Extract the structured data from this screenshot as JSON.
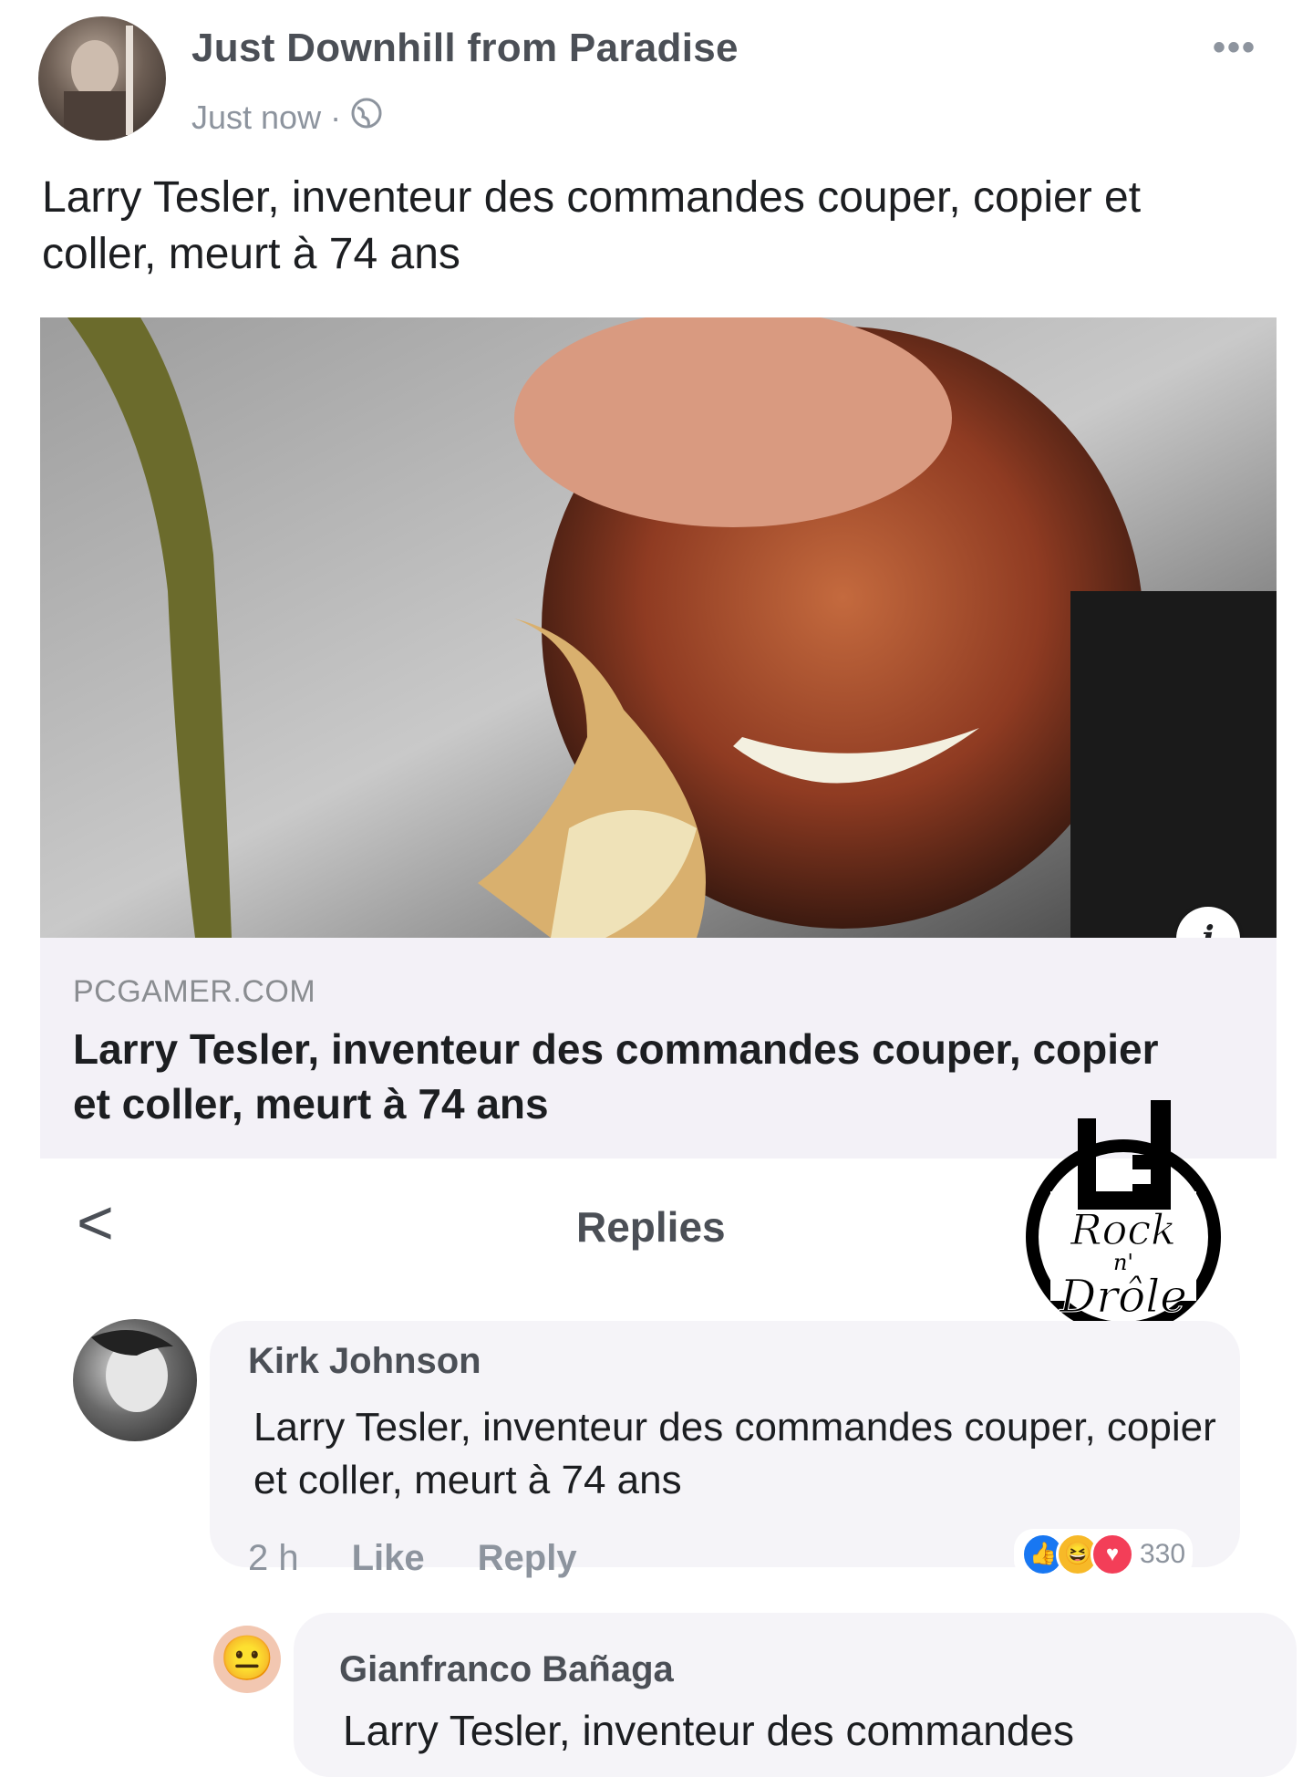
{
  "post": {
    "author": "Just Downhill from Paradise",
    "timestamp": "Just now ·",
    "timestamp_icon": "globe-icon",
    "more_icon": "more-options-icon",
    "more_label": "•••",
    "text": "Larry Tesler, inventeur des commandes couper, copier et coller, meurt à 74 ans"
  },
  "link_preview": {
    "image": "photo-of-smiling-man",
    "info_label": "i",
    "domain": "PCGAMER.COM",
    "title": "Larry Tesler, inventeur des commandes couper, copier et coller, meurt à 74 ans"
  },
  "replies": {
    "back_icon": "chevron-left-icon",
    "back_label": "<",
    "title": "Replies"
  },
  "watermark": {
    "logo_text_1": "Rock",
    "logo_text_2": "n'",
    "logo_text_3": "Drôle"
  },
  "comments": [
    {
      "name": "Kirk Johnson",
      "text": "Larry Tesler, inventeur des commandes couper, copier et coller, meurt à 74 ans",
      "time": "2 h",
      "like": "Like",
      "reply": "Reply",
      "reactions": [
        "like-reaction",
        "haha-reaction",
        "love-reaction"
      ],
      "reaction_count": "330"
    },
    {
      "name": "Gianfranco Bañaga",
      "avatar_glyph": "😐",
      "text": "Larry Tesler, inventeur des commandes"
    }
  ],
  "colors": {
    "text_primary": "#1c1e21",
    "text_secondary": "#8d949e",
    "preview_bg": "#f3f1f7",
    "like_blue": "#1877f2",
    "love_red": "#f33e58",
    "haha_yellow": "#f7b928"
  }
}
